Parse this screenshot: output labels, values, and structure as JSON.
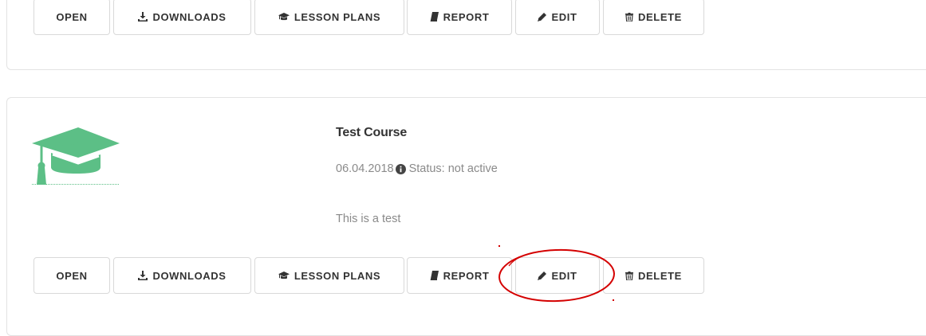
{
  "colors": {
    "accent_green": "#5cbf86",
    "annotation_red": "#d40000",
    "meta_gray": "#8a8a8a"
  },
  "top_card": {
    "buttons": [
      {
        "label": "OPEN",
        "icon": null
      },
      {
        "label": "DOWNLOADS",
        "icon": "download-icon"
      },
      {
        "label": "LESSON PLANS",
        "icon": "graduation-cap-icon"
      },
      {
        "label": "REPORT",
        "icon": "book-icon"
      },
      {
        "label": "EDIT",
        "icon": "pencil-icon"
      },
      {
        "label": "DELETE",
        "icon": "trash-icon"
      }
    ]
  },
  "course": {
    "logo_icon": "graduation-cap-icon",
    "title": "Test Course",
    "date": "06.04.2018",
    "status": "Status: not active",
    "status_icon": "info-circle-icon",
    "description": "This is a test",
    "buttons": [
      {
        "label": "OPEN",
        "icon": null
      },
      {
        "label": "DOWNLOADS",
        "icon": "download-icon"
      },
      {
        "label": "LESSON PLANS",
        "icon": "graduation-cap-icon"
      },
      {
        "label": "REPORT",
        "icon": "book-icon"
      },
      {
        "label": "EDIT",
        "icon": "pencil-icon",
        "highlighted": true
      },
      {
        "label": "DELETE",
        "icon": "trash-icon"
      }
    ]
  }
}
